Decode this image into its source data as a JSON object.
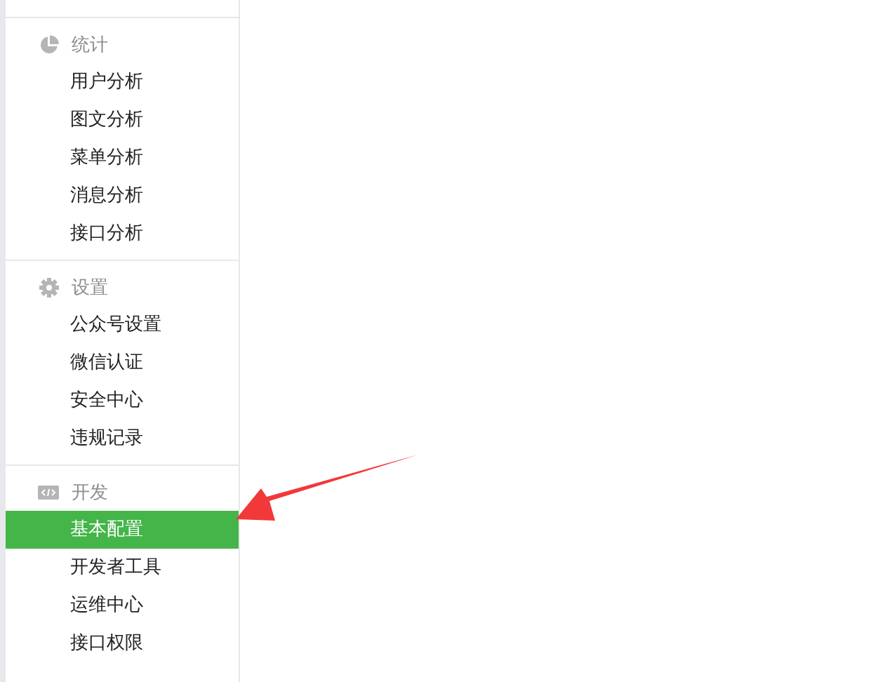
{
  "sidebar": {
    "sections": [
      {
        "title": "统计",
        "items": [
          {
            "label": "用户分析",
            "selected": false
          },
          {
            "label": "图文分析",
            "selected": false
          },
          {
            "label": "菜单分析",
            "selected": false
          },
          {
            "label": "消息分析",
            "selected": false
          },
          {
            "label": "接口分析",
            "selected": false
          }
        ]
      },
      {
        "title": "设置",
        "items": [
          {
            "label": "公众号设置",
            "selected": false
          },
          {
            "label": "微信认证",
            "selected": false
          },
          {
            "label": "安全中心",
            "selected": false
          },
          {
            "label": "违规记录",
            "selected": false
          }
        ]
      },
      {
        "title": "开发",
        "items": [
          {
            "label": "基本配置",
            "selected": true
          },
          {
            "label": "开发者工具",
            "selected": false
          },
          {
            "label": "运维中心",
            "selected": false
          },
          {
            "label": "接口权限",
            "selected": false
          }
        ]
      }
    ]
  }
}
